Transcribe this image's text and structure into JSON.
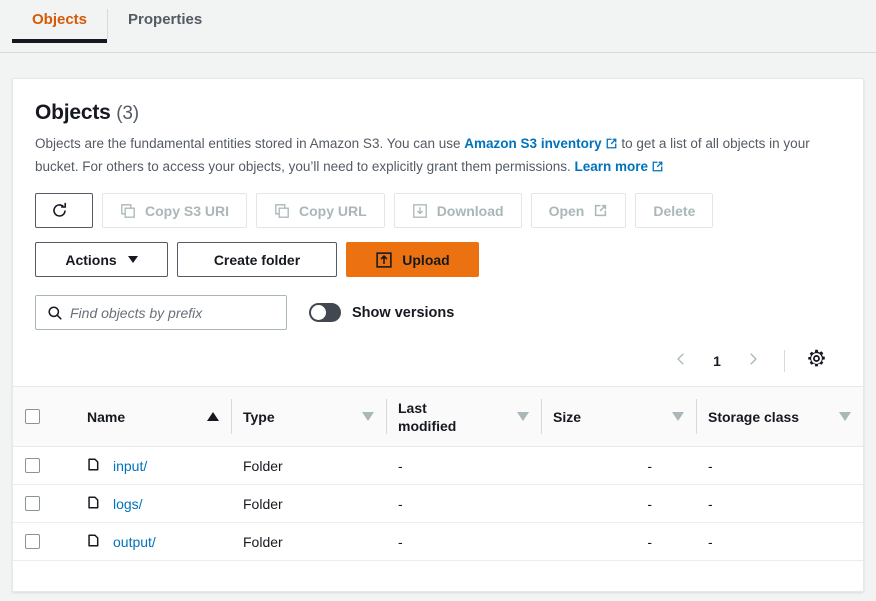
{
  "tabs": [
    {
      "label": "Objects",
      "active": true
    },
    {
      "label": "Properties",
      "active": false
    }
  ],
  "panel": {
    "title": "Objects",
    "count": "(3)",
    "description_part1": "Objects are the fundamental entities stored in Amazon S3. You can use",
    "inventory_link": "Amazon S3 inventory",
    "description_part2": "to get a list of all objects in your bucket. For others to access your objects, you’ll need to explicitly grant them permissions.",
    "learn_more_link": "Learn more"
  },
  "actions": {
    "refresh_label": "",
    "copy_s3_uri": "Copy S3 URI",
    "copy_url": "Copy URL",
    "download": "Download",
    "open": "Open",
    "delete": "Delete",
    "actions_menu": "Actions",
    "create_folder": "Create folder",
    "upload": "Upload"
  },
  "search": {
    "placeholder": "Find objects by prefix",
    "value": ""
  },
  "versions_toggle": {
    "label": "Show versions",
    "state": "off"
  },
  "pagination": {
    "current_page": "1"
  },
  "table": {
    "columns": [
      {
        "label": "Name",
        "sort": "asc"
      },
      {
        "label": "Type",
        "sort": "none"
      },
      {
        "label": "Last modified",
        "sort": "none"
      },
      {
        "label": "Size",
        "sort": "none"
      },
      {
        "label": "Storage class",
        "sort": "none"
      }
    ],
    "rows": [
      {
        "name": "input/",
        "type": "Folder",
        "last_modified": "-",
        "size": "-",
        "storage_class": "-"
      },
      {
        "name": "logs/",
        "type": "Folder",
        "last_modified": "-",
        "size": "-",
        "storage_class": "-"
      },
      {
        "name": "output/",
        "type": "Folder",
        "last_modified": "-",
        "size": "-",
        "storage_class": "-"
      }
    ]
  },
  "colors": {
    "accent_orange": "#ec7211",
    "tab_active_text": "#d45b07",
    "link_blue": "#0073bb",
    "disabled_text": "#aab7b8"
  }
}
